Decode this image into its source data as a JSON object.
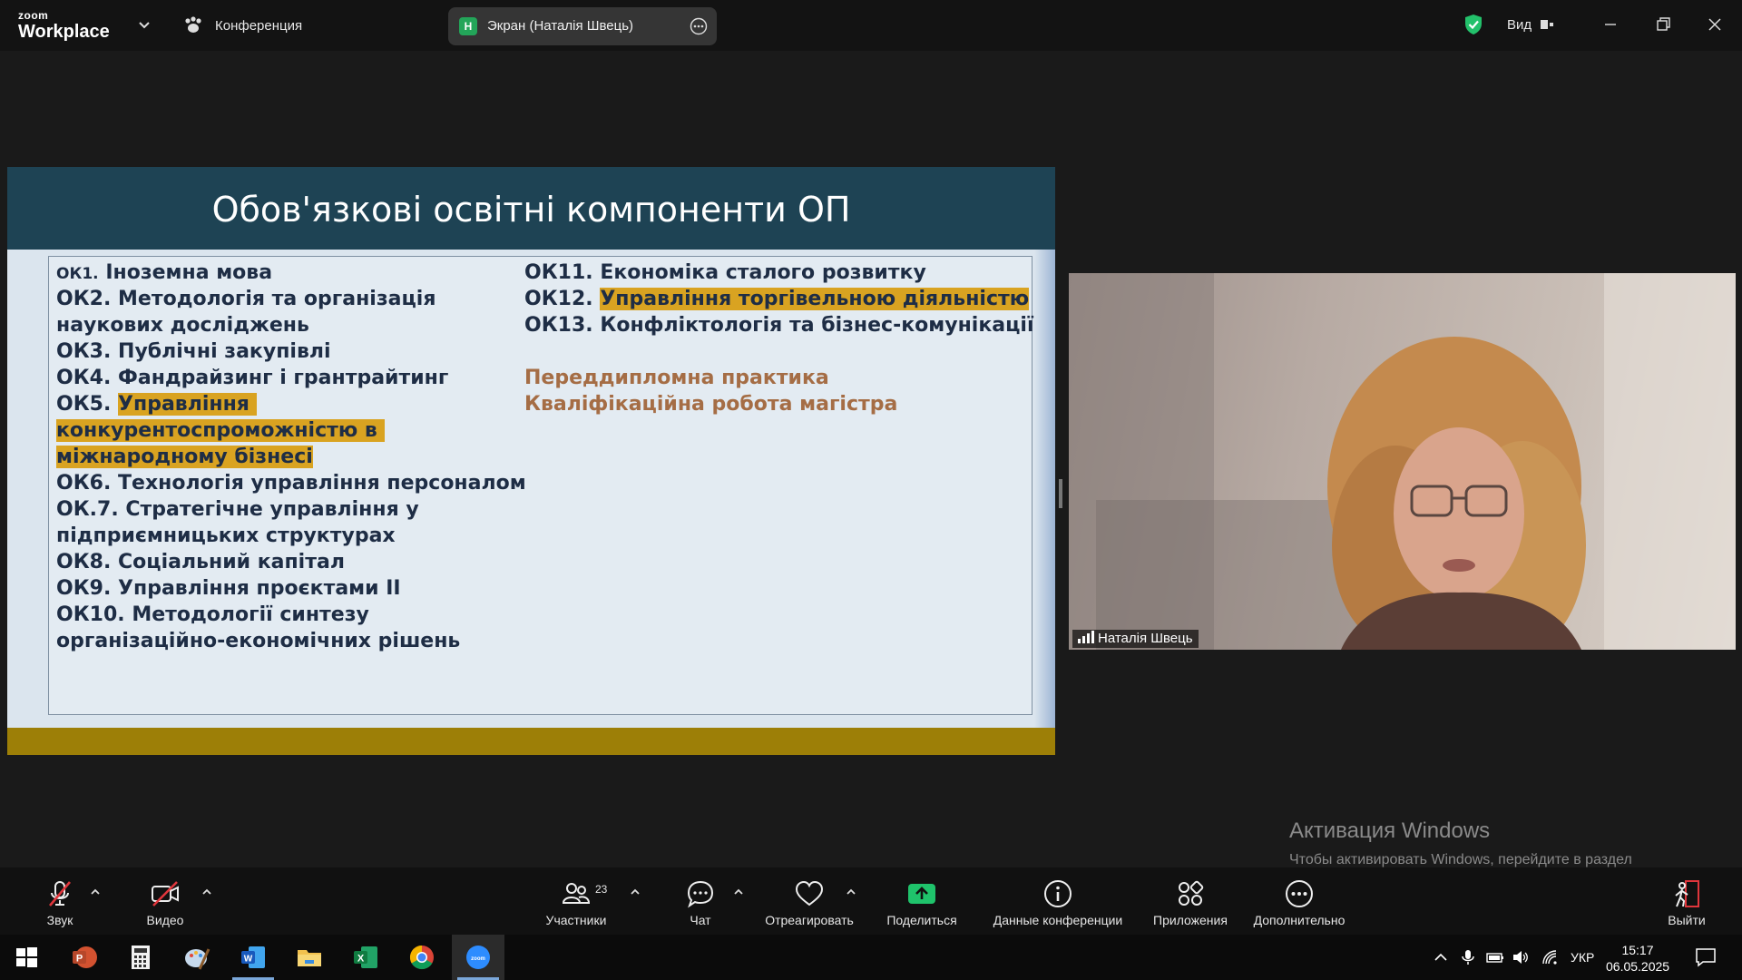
{
  "app": {
    "brand_line1": "zoom",
    "brand_line2": "Workplace",
    "meeting_label": "Конференция",
    "share_avatar_letter": "Н",
    "share_label": "Экран (Наталія Швець)",
    "view_label": "Вид"
  },
  "slide": {
    "title": "Обов'язкові освітні компоненти ОП",
    "left_items": [
      {
        "prefix": "ОК1.",
        "text": "Іноземна мова"
      },
      {
        "prefix": "ОК2.",
        "text": "Методологія та організація"
      },
      {
        "prefix": "",
        "text": "наукових досліджень"
      },
      {
        "prefix": "ОК3.",
        "text": "Публічні закупівлі"
      },
      {
        "prefix": "ОК4.",
        "text": "Фандрайзинг і грантрайтинг"
      },
      {
        "prefix": "ОК5.",
        "text": "Управління"
      },
      {
        "prefix": "",
        "text": "конкурентоспроможністю в"
      },
      {
        "prefix": "",
        "text": "міжнародному бізнесі"
      },
      {
        "prefix": "ОК6.",
        "text": "Технологія управління персоналом"
      },
      {
        "prefix": "ОК.7.",
        "text": "Стратегічне управління у"
      },
      {
        "prefix": "",
        "text": "підприємницьких структурах"
      },
      {
        "prefix": "ОК8.",
        "text": "Соціальний капітал"
      },
      {
        "prefix": "ОК9.",
        "text": "Управління проєктами ІІ"
      },
      {
        "prefix": "ОК10.",
        "text": "Методології синтезу"
      },
      {
        "prefix": "",
        "text": "організаційно-економічних рішень"
      }
    ],
    "right_items": [
      {
        "prefix": "ОК11.",
        "text": "Економіка сталого розвитку"
      },
      {
        "prefix": "ОК12.",
        "text": "Управління торгівельною діяльністю"
      },
      {
        "prefix": "ОК13.",
        "text": "Конфліктологія та бізнес-комунікації"
      }
    ],
    "practice_items": [
      "Переддипломна практика",
      "Кваліфікаційна робота магістра"
    ],
    "highlight_color": "#d9a321",
    "header_color": "#1e4354",
    "footer_color": "#9d7f07"
  },
  "video": {
    "participant_name": "Наталія Швець"
  },
  "watermark": {
    "title": "Активация Windows",
    "text": "Чтобы активировать Windows, перейдите в раздел \"Параметры\"."
  },
  "toolbar": {
    "audio": "Звук",
    "video": "Видео",
    "participants": "Участники",
    "participants_count": "23",
    "chat": "Чат",
    "react": "Отреагировать",
    "share": "Поделиться",
    "meeting_info": "Данные конференции",
    "apps": "Приложения",
    "more": "Дополнительно",
    "leave": "Выйти"
  },
  "taskbar": {
    "language": "УКР",
    "time": "15:17",
    "date": "06.05.2025"
  }
}
